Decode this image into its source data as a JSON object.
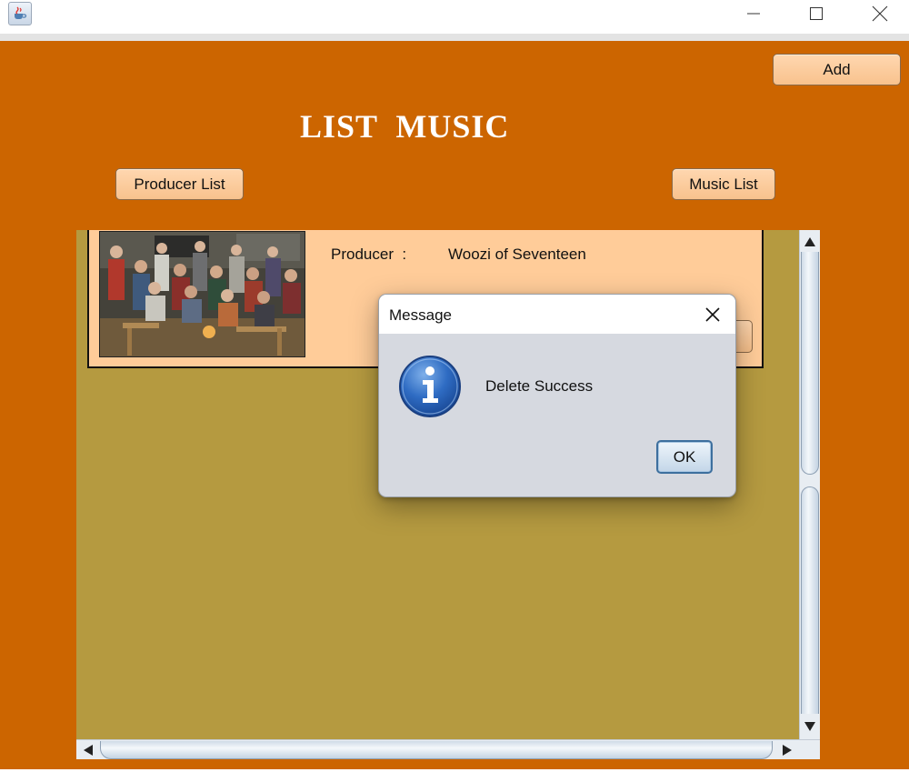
{
  "window": {
    "icons": {
      "app": "java-coffee-cup-icon",
      "minimize": "minimize-icon",
      "maximize": "maximize-icon",
      "close": "close-icon"
    }
  },
  "header": {
    "add_label": "Add",
    "title": "LIST  MUSIC",
    "producer_list_label": "Producer List",
    "music_list_label": "Music List"
  },
  "card": {
    "producer_label": "Producer  :",
    "producer_value": "Woozi of Seventeen"
  },
  "dialog": {
    "title": "Message",
    "message": "Delete Success",
    "ok_label": "OK",
    "icon": "info-icon"
  },
  "colors": {
    "frame_background": "#cc6500",
    "list_background": "#b59a40",
    "card_background": "#ffcc99",
    "button_background": "#f8c28d",
    "dialog_background": "#d6d9e0"
  }
}
